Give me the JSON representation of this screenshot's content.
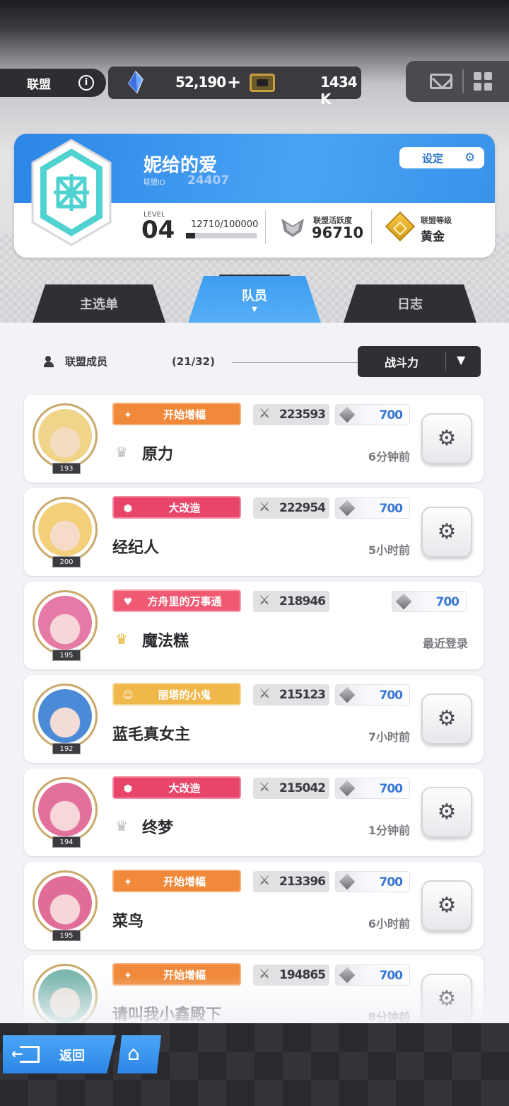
{
  "header": {
    "alliance_tab": "联盟",
    "info_icon": "i",
    "crystal_icon": "crystal-icon",
    "crystals": "52,190",
    "plus": "+",
    "ticket_icon": "ticket-icon",
    "tickets": "1434 K",
    "mail_icon": "mail-icon",
    "menu_icon": "grid-menu-icon"
  },
  "alliance": {
    "name": "妮给的爱",
    "id_label": "联盟ID",
    "id": "24407",
    "settings_label": "设定",
    "level_label": "LEVEL",
    "level": "04",
    "exp_text": "12710/100000",
    "exp_progress": 0.1271,
    "activity_label": "联盟活跃度",
    "activity": "96710",
    "grade_label": "联盟等级",
    "grade": "黄金"
  },
  "tabs": [
    {
      "label": "主选单"
    },
    {
      "label": "队员",
      "active": true
    },
    {
      "label": "日志"
    }
  ],
  "members_panel": {
    "header": "联盟成员",
    "count": "(21/32)",
    "sort_label": "战斗力",
    "sort_arrow": "▼"
  },
  "members": [
    {
      "badge": "开始增幅",
      "badge_style": "orange",
      "badge_icon": "✦",
      "power": "223593",
      "gems": "700",
      "crown": "silver",
      "name": "原力",
      "time": "6分钟前",
      "level": "193",
      "has_gear": true,
      "face": "#f3dcc0",
      "hair": "#f0d48a"
    },
    {
      "badge": "大改造",
      "badge_style": "red",
      "badge_icon": "⬢",
      "power": "222954",
      "gems": "700",
      "crown": "",
      "name": "经纪人",
      "time": "5小时前",
      "level": "200",
      "has_gear": true,
      "face": "#f6dcc8",
      "hair": "#f2cf78"
    },
    {
      "badge": "方舟里的万事通",
      "badge_style": "pink",
      "badge_icon": "♥",
      "power": "218946",
      "gems": "700",
      "crown": "gold",
      "name": "魔法糕",
      "time": "最近登录",
      "level": "195",
      "has_gear": false,
      "face": "#f6d6d8",
      "hair": "#e57aa6"
    },
    {
      "badge": "丽塔的小鬼",
      "badge_style": "gold",
      "badge_icon": "☺",
      "power": "215123",
      "gems": "700",
      "crown": "",
      "name": "蓝毛真女主",
      "time": "7小时前",
      "level": "192",
      "has_gear": true,
      "face": "#f4dcd6",
      "hair": "#4a8ad6"
    },
    {
      "badge": "大改造",
      "badge_style": "red",
      "badge_icon": "⬢",
      "power": "215042",
      "gems": "700",
      "crown": "silver",
      "name": "终梦",
      "time": "1分钟前",
      "level": "194",
      "has_gear": true,
      "face": "#f6d8da",
      "hair": "#e2709c"
    },
    {
      "badge": "开始增幅",
      "badge_style": "orange",
      "badge_icon": "✦",
      "power": "213396",
      "gems": "700",
      "crown": "",
      "name": "菜鸟",
      "time": "6小时前",
      "level": "195",
      "has_gear": true,
      "face": "#f6d6d8",
      "hair": "#e06d98"
    },
    {
      "badge": "开始增幅",
      "badge_style": "orange",
      "badge_icon": "✦",
      "power": "194865",
      "gems": "700",
      "crown": "",
      "name": "请叫我小鑫殿下",
      "time": "8分钟前",
      "level": "",
      "has_gear": true,
      "face": "#e8e0d6",
      "hair": "#7fb8b0"
    }
  ],
  "footer": {
    "back_label": "返回",
    "home_icon": "home-icon"
  }
}
